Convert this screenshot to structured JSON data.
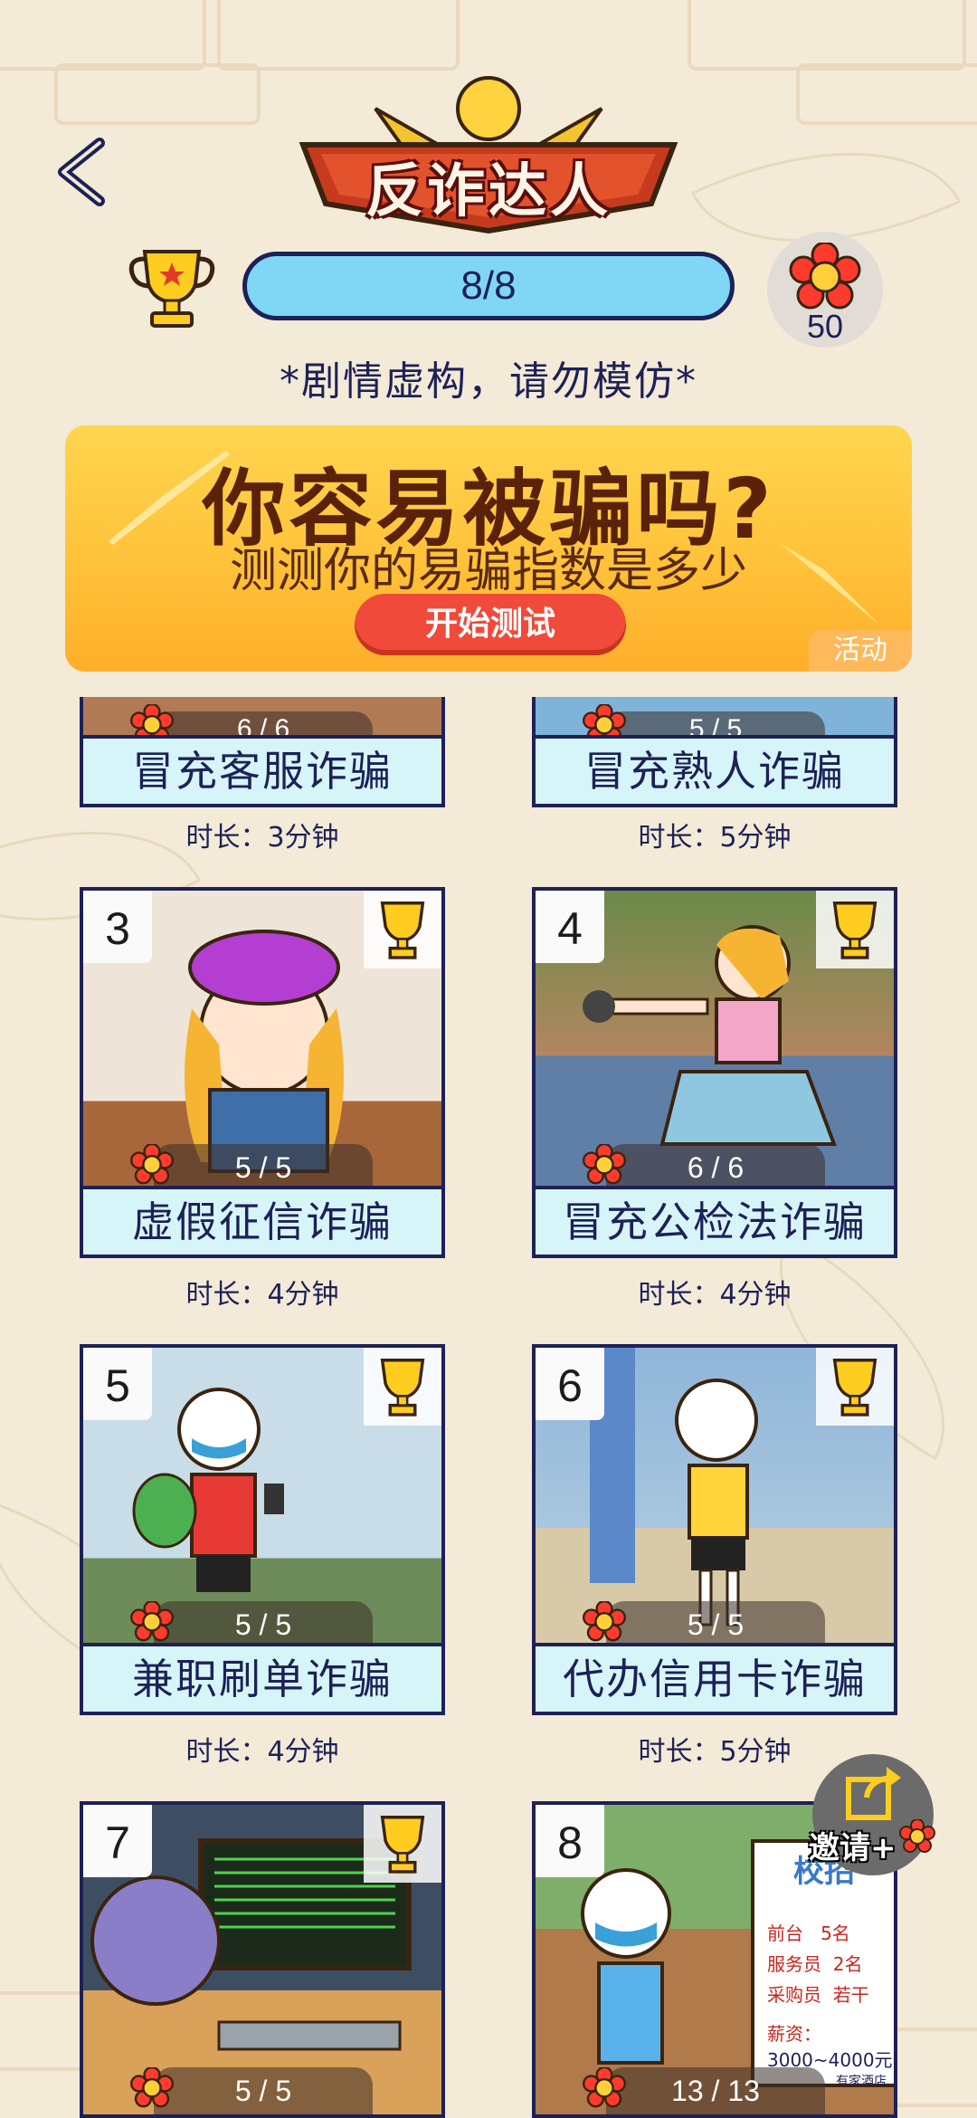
{
  "header": {
    "title": "反诈达人",
    "progress": "8/8",
    "flower_count": "50",
    "disclaimer": "*剧情虚构，请勿模仿*"
  },
  "activity": {
    "title": "你容易被骗吗?",
    "subtitle": "测测你的易骗指数是多少",
    "button_label": "开始测试",
    "tag": "活动"
  },
  "cards": [
    {
      "label": "冒充客服诈骗",
      "progress": "6 / 6",
      "duration": "时长：3分钟"
    },
    {
      "label": "冒充熟人诈骗",
      "progress": "5 / 5",
      "duration": "时长：5分钟"
    },
    {
      "number": "3",
      "label": "虚假征信诈骗",
      "progress": "5 / 5",
      "duration": "时长：4分钟"
    },
    {
      "number": "4",
      "label": "冒充公检法诈骗",
      "progress": "6 / 6",
      "duration": "时长：4分钟"
    },
    {
      "number": "5",
      "label": "兼职刷单诈骗",
      "progress": "5 / 5",
      "duration": "时长：4分钟"
    },
    {
      "number": "6",
      "label": "代办信用卡诈骗",
      "progress": "5 / 5",
      "duration": "时长：5分钟"
    },
    {
      "number": "7",
      "progress": "5 / 5"
    },
    {
      "number": "8",
      "progress": "13 / 13"
    }
  ],
  "card8_poster": {
    "heading": "校招",
    "rows": [
      {
        "role": "前台",
        "count": "5名"
      },
      {
        "role": "服务员",
        "count": "2名"
      },
      {
        "role": "采购员",
        "count": "若干"
      }
    ],
    "salary_label": "薪资：",
    "salary": "3000~4000元",
    "hotel": "有家酒店"
  },
  "invite": {
    "label": "邀请+"
  },
  "colors": {
    "navy": "#1d2157",
    "sky": "#7fd7f5",
    "label_bg": "#d6f5f8",
    "accent_red": "#f04a3a",
    "banner_yellow": "#ffc23a"
  }
}
